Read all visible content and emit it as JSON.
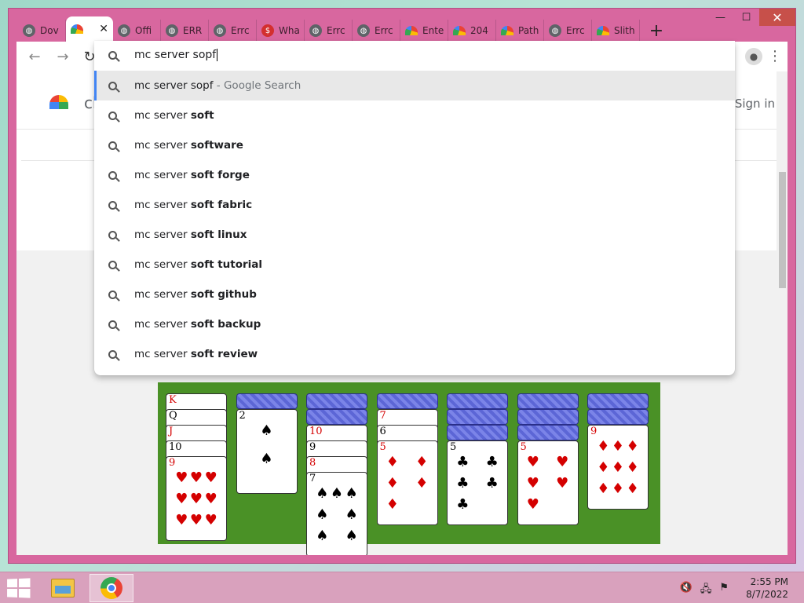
{
  "browser": {
    "tabs": [
      {
        "label": "Dov",
        "icon": "globe-icon",
        "color": "#5f6368"
      },
      {
        "label": "",
        "icon": "site-logo-icon",
        "color": "#e0843c",
        "active": true
      },
      {
        "label": "Offi",
        "icon": "globe-icon",
        "color": "#5f6368"
      },
      {
        "label": "ERR",
        "icon": "globe-icon",
        "color": "#5f6368"
      },
      {
        "label": "Errc",
        "icon": "globe-icon",
        "color": "#5f6368"
      },
      {
        "label": "Wha",
        "icon": "dollar-icon",
        "color": "#d32f2f"
      },
      {
        "label": "Errc",
        "icon": "globe-icon",
        "color": "#5f6368"
      },
      {
        "label": "Errc",
        "icon": "globe-icon",
        "color": "#5f6368"
      },
      {
        "label": "Ente",
        "icon": "site-logo-icon",
        "color": "#e0843c"
      },
      {
        "label": "204",
        "icon": "site-logo-icon",
        "color": "#e0843c"
      },
      {
        "label": "Path",
        "icon": "site-logo-icon",
        "color": "#e0843c"
      },
      {
        "label": "Errc",
        "icon": "globe-icon",
        "color": "#5f6368"
      },
      {
        "label": "Slith",
        "icon": "site-logo-icon",
        "color": "#e0843c"
      }
    ],
    "new_tab": "+",
    "window_controls": {
      "minimize": "—",
      "maximize": "☐",
      "close": "✕"
    },
    "nav": {
      "back": "←",
      "forward": "→",
      "reload": "↻"
    },
    "omnibox_value": "mc server sopf"
  },
  "suggestions": [
    {
      "prefix": "mc server sopf",
      "suffix": "",
      "hint": " - Google Search",
      "selected": true
    },
    {
      "prefix": "mc server ",
      "suffix": "soft",
      "hint": ""
    },
    {
      "prefix": "mc server ",
      "suffix": "software",
      "hint": ""
    },
    {
      "prefix": "mc server ",
      "suffix": "soft forge",
      "hint": ""
    },
    {
      "prefix": "mc server ",
      "suffix": "soft fabric",
      "hint": ""
    },
    {
      "prefix": "mc server ",
      "suffix": "soft linux",
      "hint": ""
    },
    {
      "prefix": "mc server ",
      "suffix": "soft tutorial",
      "hint": ""
    },
    {
      "prefix": "mc server ",
      "suffix": "soft github",
      "hint": ""
    },
    {
      "prefix": "mc server ",
      "suffix": "soft backup",
      "hint": ""
    },
    {
      "prefix": "mc server ",
      "suffix": "soft review",
      "hint": ""
    }
  ],
  "page": {
    "site_name": "ch",
    "sign_in": "Sign in"
  },
  "solitaire": {
    "columns": [
      {
        "backs": 0,
        "cards": [
          {
            "rank": "K",
            "suit": "♥",
            "color": "red"
          },
          {
            "rank": "Q",
            "suit": "♣",
            "color": "black"
          },
          {
            "rank": "J",
            "suit": "♥",
            "color": "red"
          },
          {
            "rank": "10",
            "suit": "♣",
            "color": "black"
          },
          {
            "rank": "9",
            "suit": "♥",
            "color": "red"
          }
        ]
      },
      {
        "backs": 1,
        "cards": [
          {
            "rank": "2",
            "suit": "♠",
            "color": "black"
          }
        ]
      },
      {
        "backs": 2,
        "cards": [
          {
            "rank": "10",
            "suit": "♥",
            "color": "red"
          },
          {
            "rank": "9",
            "suit": "♠",
            "color": "black"
          },
          {
            "rank": "8",
            "suit": "♥",
            "color": "red"
          },
          {
            "rank": "7",
            "suit": "♠",
            "color": "black"
          }
        ]
      },
      {
        "backs": 1,
        "cards": [
          {
            "rank": "7",
            "suit": "♥",
            "color": "red"
          },
          {
            "rank": "6",
            "suit": "♠",
            "color": "black"
          },
          {
            "rank": "5",
            "suit": "♦",
            "color": "red"
          }
        ]
      },
      {
        "backs": 3,
        "cards": [
          {
            "rank": "5",
            "suit": "♣",
            "color": "black"
          }
        ]
      },
      {
        "backs": 3,
        "cards": [
          {
            "rank": "5",
            "suit": "♥",
            "color": "red"
          }
        ]
      },
      {
        "backs": 2,
        "cards": [
          {
            "rank": "9",
            "suit": "♦",
            "color": "red"
          }
        ]
      }
    ]
  },
  "taskbar": {
    "apps": [
      {
        "name": "file-explorer",
        "active": false
      },
      {
        "name": "chrome",
        "active": true
      }
    ],
    "tray_icons": [
      "🔇",
      "🖧",
      "⚑"
    ],
    "time": "2:55 PM",
    "date": "8/7/2022"
  }
}
